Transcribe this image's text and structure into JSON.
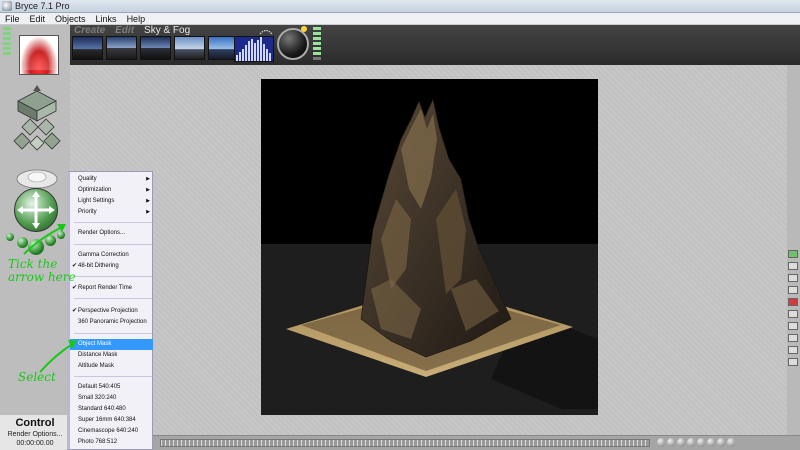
{
  "window": {
    "title": "Bryce 7.1 Pro"
  },
  "menubar": {
    "items": [
      "File",
      "Edit",
      "Objects",
      "Links",
      "Help"
    ]
  },
  "topbar": {
    "tabs": [
      {
        "label": "Create",
        "active": false
      },
      {
        "label": "Edit",
        "active": false
      },
      {
        "label": "Sky & Fog",
        "active": true
      }
    ],
    "preset_count": 6
  },
  "control": {
    "title": "Control",
    "subtitle": "Render Options...",
    "time": "00:00:00.00"
  },
  "context_menu": {
    "items": [
      {
        "label": "Quality",
        "submenu": true
      },
      {
        "label": "Optimization",
        "submenu": true
      },
      {
        "label": "Light Settings",
        "submenu": true
      },
      {
        "label": "Priority",
        "submenu": true
      },
      {
        "separator": true
      },
      {
        "label": "Render Options..."
      },
      {
        "separator": true
      },
      {
        "label": "Gamma Correction"
      },
      {
        "label": "48-bit Dithering",
        "checked": true
      },
      {
        "separator": true
      },
      {
        "label": "Report Render Time",
        "checked": true
      },
      {
        "separator": true
      },
      {
        "label": "Perspective Projection",
        "checked": true
      },
      {
        "label": "360 Panoramic Projection"
      },
      {
        "separator": true
      },
      {
        "label": "Object Mask",
        "highlighted": true
      },
      {
        "label": "Distance Mask"
      },
      {
        "label": "Altitude Mask"
      },
      {
        "separator": true
      },
      {
        "label": "Default 540:405"
      },
      {
        "label": "Small 320:240"
      },
      {
        "label": "Standard 640:480"
      },
      {
        "label": "Super 16mm 640:384"
      },
      {
        "label": "Cinemascope 640:240"
      },
      {
        "label": "Photo 768:512"
      }
    ]
  },
  "annotations": {
    "tick_arrow": [
      "Tick the",
      "arrow here"
    ],
    "select": "Select"
  },
  "colors": {
    "annotation": "#18c818",
    "menu_highlight": "#3399ff",
    "topbar": "#333333"
  }
}
